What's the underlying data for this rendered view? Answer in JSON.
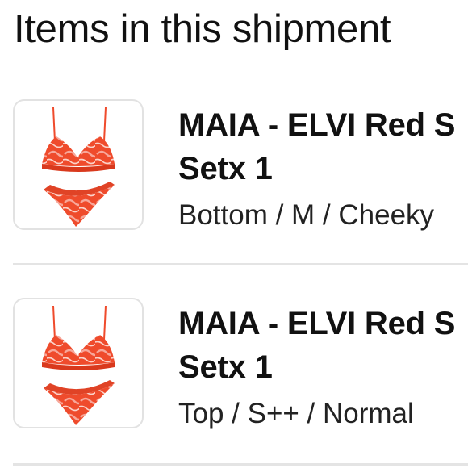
{
  "page": {
    "title": "Items in this shipment"
  },
  "colors": {
    "product_red": "#ef4b2c",
    "product_pink": "#f7a79a",
    "divider": "#e4e4e4",
    "thumb_border": "#e2e2e2"
  },
  "items": [
    {
      "thumbnail_icon": "red-swirl-bikini-image",
      "name_line1": "MAIA - ELVI Red S",
      "name_line2": "Setx 1",
      "variant": "Bottom / M / Cheeky"
    },
    {
      "thumbnail_icon": "red-swirl-bikini-image",
      "name_line1": "MAIA - ELVI Red S",
      "name_line2": "Setx 1",
      "variant": "Top / S++ / Normal"
    }
  ]
}
